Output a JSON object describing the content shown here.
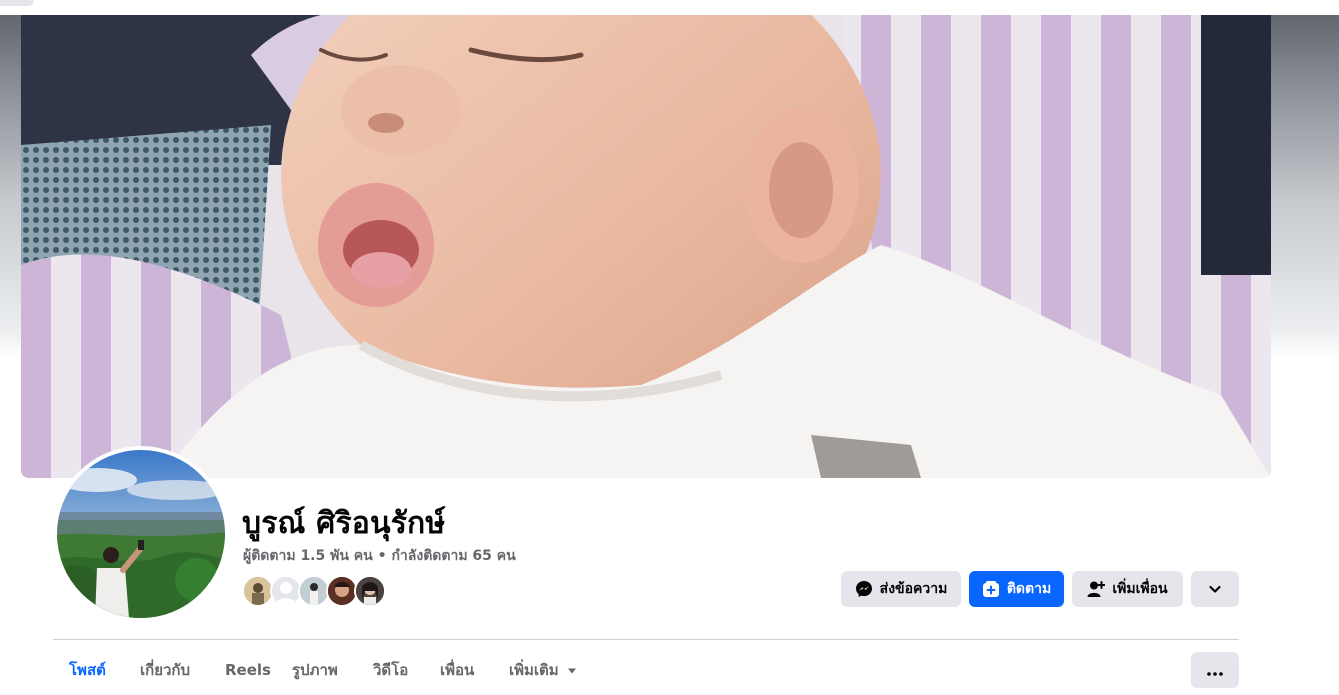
{
  "profile": {
    "name": "บูรณ์ ศิริอนุรักษ์",
    "followers_text": "ผู้ติดตาม 1.5 พัน คน",
    "separator": " • ",
    "following_text": "กำลังติดตาม 65 คน"
  },
  "actions": {
    "message_label": "ส่งข้อความ",
    "follow_label": "ติดตาม",
    "add_friend_label": "เพิ่มเพื่อน"
  },
  "tabs": [
    {
      "label": "โพสต์",
      "active": true
    },
    {
      "label": "เกี่ยวกับ"
    },
    {
      "label": "Reels"
    },
    {
      "label": "รูปภาพ"
    },
    {
      "label": "วิดีโอ"
    },
    {
      "label": "เพื่อน"
    },
    {
      "label": "เพิ่มเติม"
    }
  ],
  "icons": {
    "message": "messenger-icon",
    "follow": "follow-icon",
    "add_friend": "add-friend-icon",
    "menu": "chevron-down-icon",
    "more_tab": "caret-down-icon",
    "overflow": "more-dots-icon"
  },
  "colors": {
    "accent": "#0866ff",
    "secondary_button": "#e4e6eb",
    "muted_text": "#65676b"
  }
}
